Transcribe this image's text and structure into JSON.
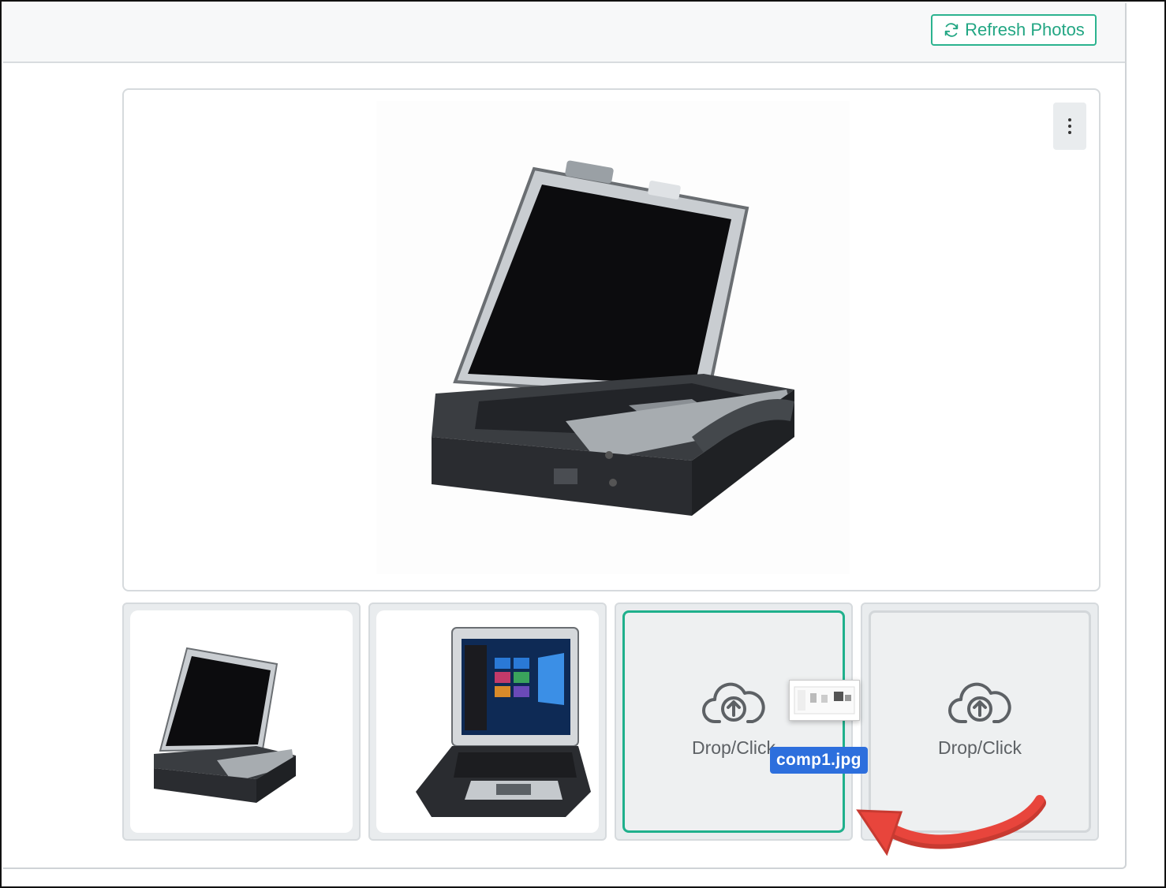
{
  "toolbar": {
    "refresh_label": "Refresh Photos"
  },
  "main_photo": {
    "alt": "Rugged laptop, open, angled view",
    "menu_icon": "vertical-ellipsis-icon"
  },
  "thumbnails": [
    {
      "alt": "Rugged laptop angled view"
    },
    {
      "alt": "Rugged laptop front view with Windows start screen"
    }
  ],
  "dropzones": [
    {
      "label": "Drop/Click",
      "icon": "cloud-upload-icon",
      "active": true
    },
    {
      "label": "Drop/Click",
      "icon": "cloud-upload-icon",
      "active": false
    }
  ],
  "drag_overlay": {
    "filename": "comp1.jpg"
  },
  "colors": {
    "accent": "#22a683",
    "drag_badge": "#2d6fdd",
    "arrow": "#e8453c"
  }
}
